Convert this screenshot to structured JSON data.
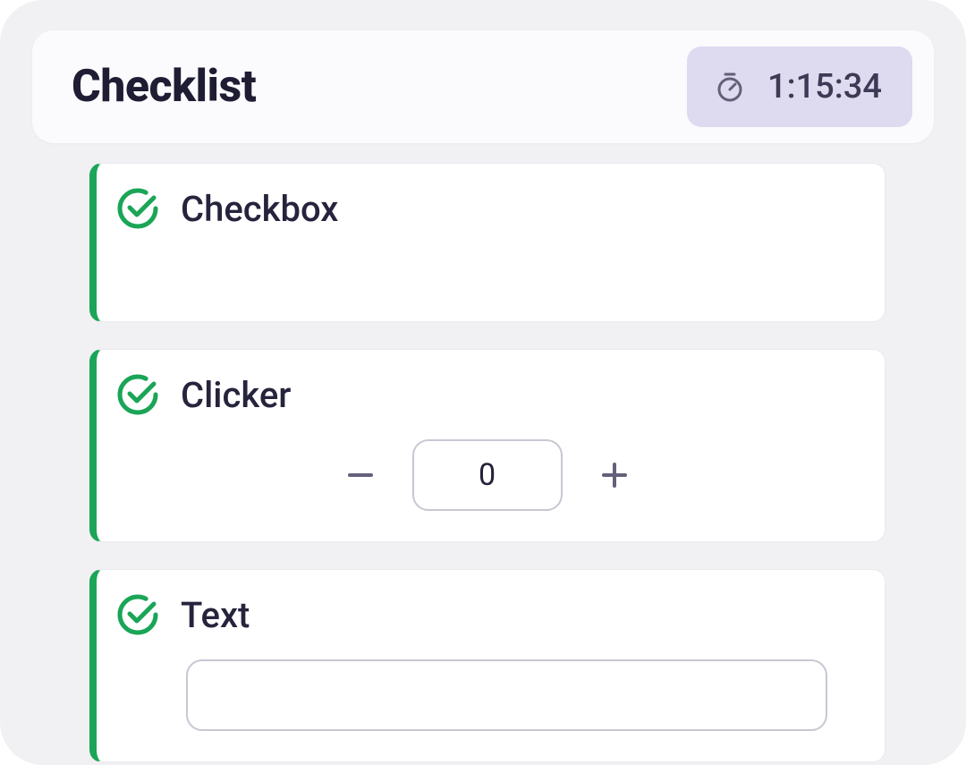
{
  "header": {
    "title": "Checklist",
    "timer": "1:15:34"
  },
  "items": {
    "checkbox": {
      "label": "Checkbox"
    },
    "clicker": {
      "label": "Clicker",
      "count": "0"
    },
    "text": {
      "label": "Text",
      "value": ""
    }
  },
  "colors": {
    "accent_green": "#1aa557",
    "badge_bg": "#dedaf0",
    "text_dark": "#1f1d33",
    "icon_muted": "#63607a"
  }
}
